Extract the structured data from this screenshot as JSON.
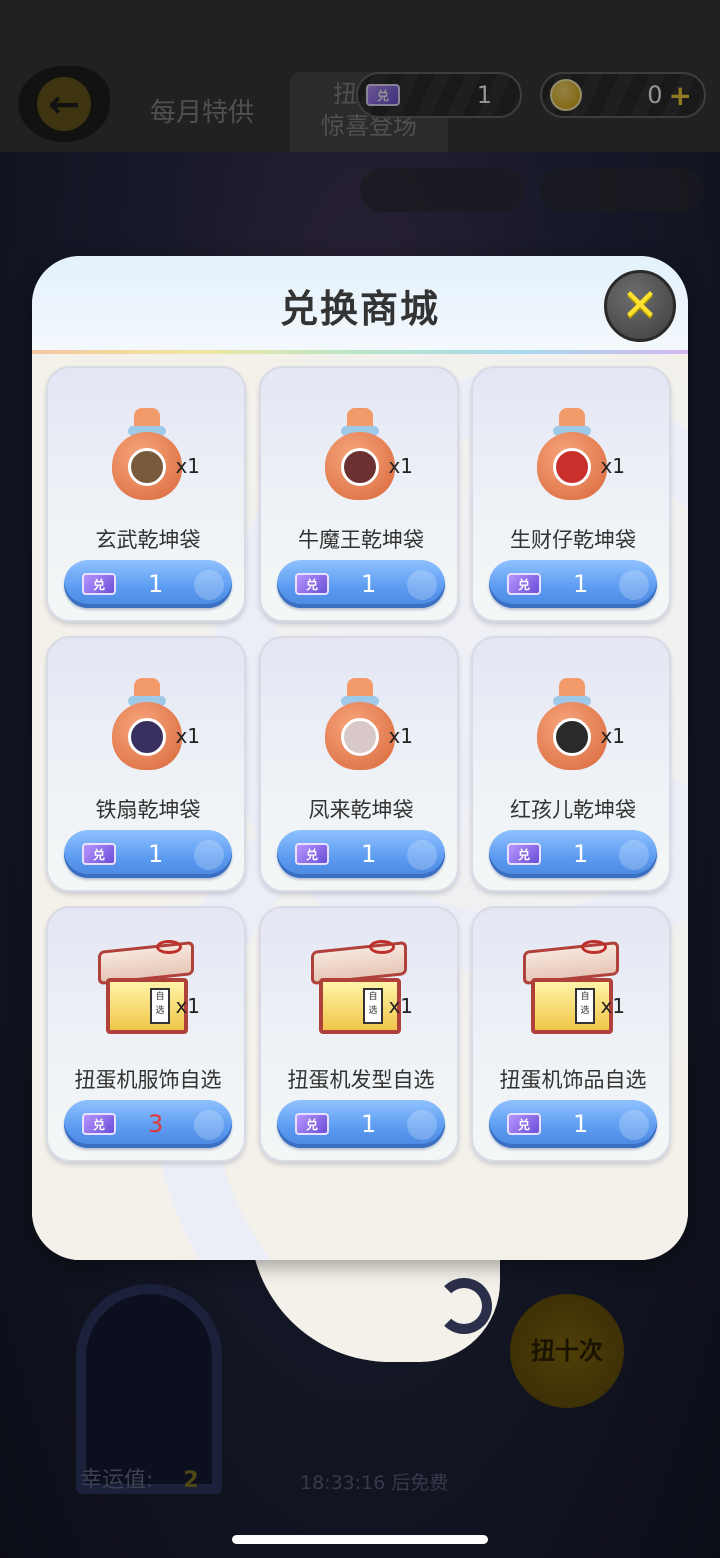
{
  "topbar": {
    "tabs": [
      {
        "label": "每月特供"
      },
      {
        "label_line1": "扭蛋机",
        "label_line2": "惊喜登场"
      }
    ],
    "ticket_count": "1",
    "coin_count": "0"
  },
  "background": {
    "lucky_label": "幸运值:",
    "lucky_value": "2",
    "ten_pull_label": "扭十次",
    "timer_text": "18:33:16 后免费"
  },
  "modal": {
    "title": "兑换商城",
    "items": [
      {
        "name": "玄武乾坤袋",
        "qty": "x1",
        "price": "1",
        "face_color": "#7a5a3c"
      },
      {
        "name": "牛魔王乾坤袋",
        "qty": "x1",
        "price": "1",
        "face_color": "#6b3030"
      },
      {
        "name": "生财仔乾坤袋",
        "qty": "x1",
        "price": "1",
        "face_color": "#c9302c"
      },
      {
        "name": "铁扇乾坤袋",
        "qty": "x1",
        "price": "1",
        "face_color": "#3a3060"
      },
      {
        "name": "凤来乾坤袋",
        "qty": "x1",
        "price": "1",
        "face_color": "#d8c8c8"
      },
      {
        "name": "红孩儿乾坤袋",
        "qty": "x1",
        "price": "1",
        "face_color": "#2a2a2a"
      },
      {
        "name": "扭蛋机服饰自选",
        "qty": "x1",
        "price": "3",
        "tag": "自选"
      },
      {
        "name": "扭蛋机发型自选",
        "qty": "x1",
        "price": "1",
        "tag": "自选"
      },
      {
        "name": "扭蛋机饰品自选",
        "qty": "x1",
        "price": "1",
        "tag": "自选"
      }
    ]
  },
  "colors": {
    "accent_blue": "#5a9af0",
    "price_red": "#e0383a",
    "close_yellow": "#ffe22e"
  }
}
